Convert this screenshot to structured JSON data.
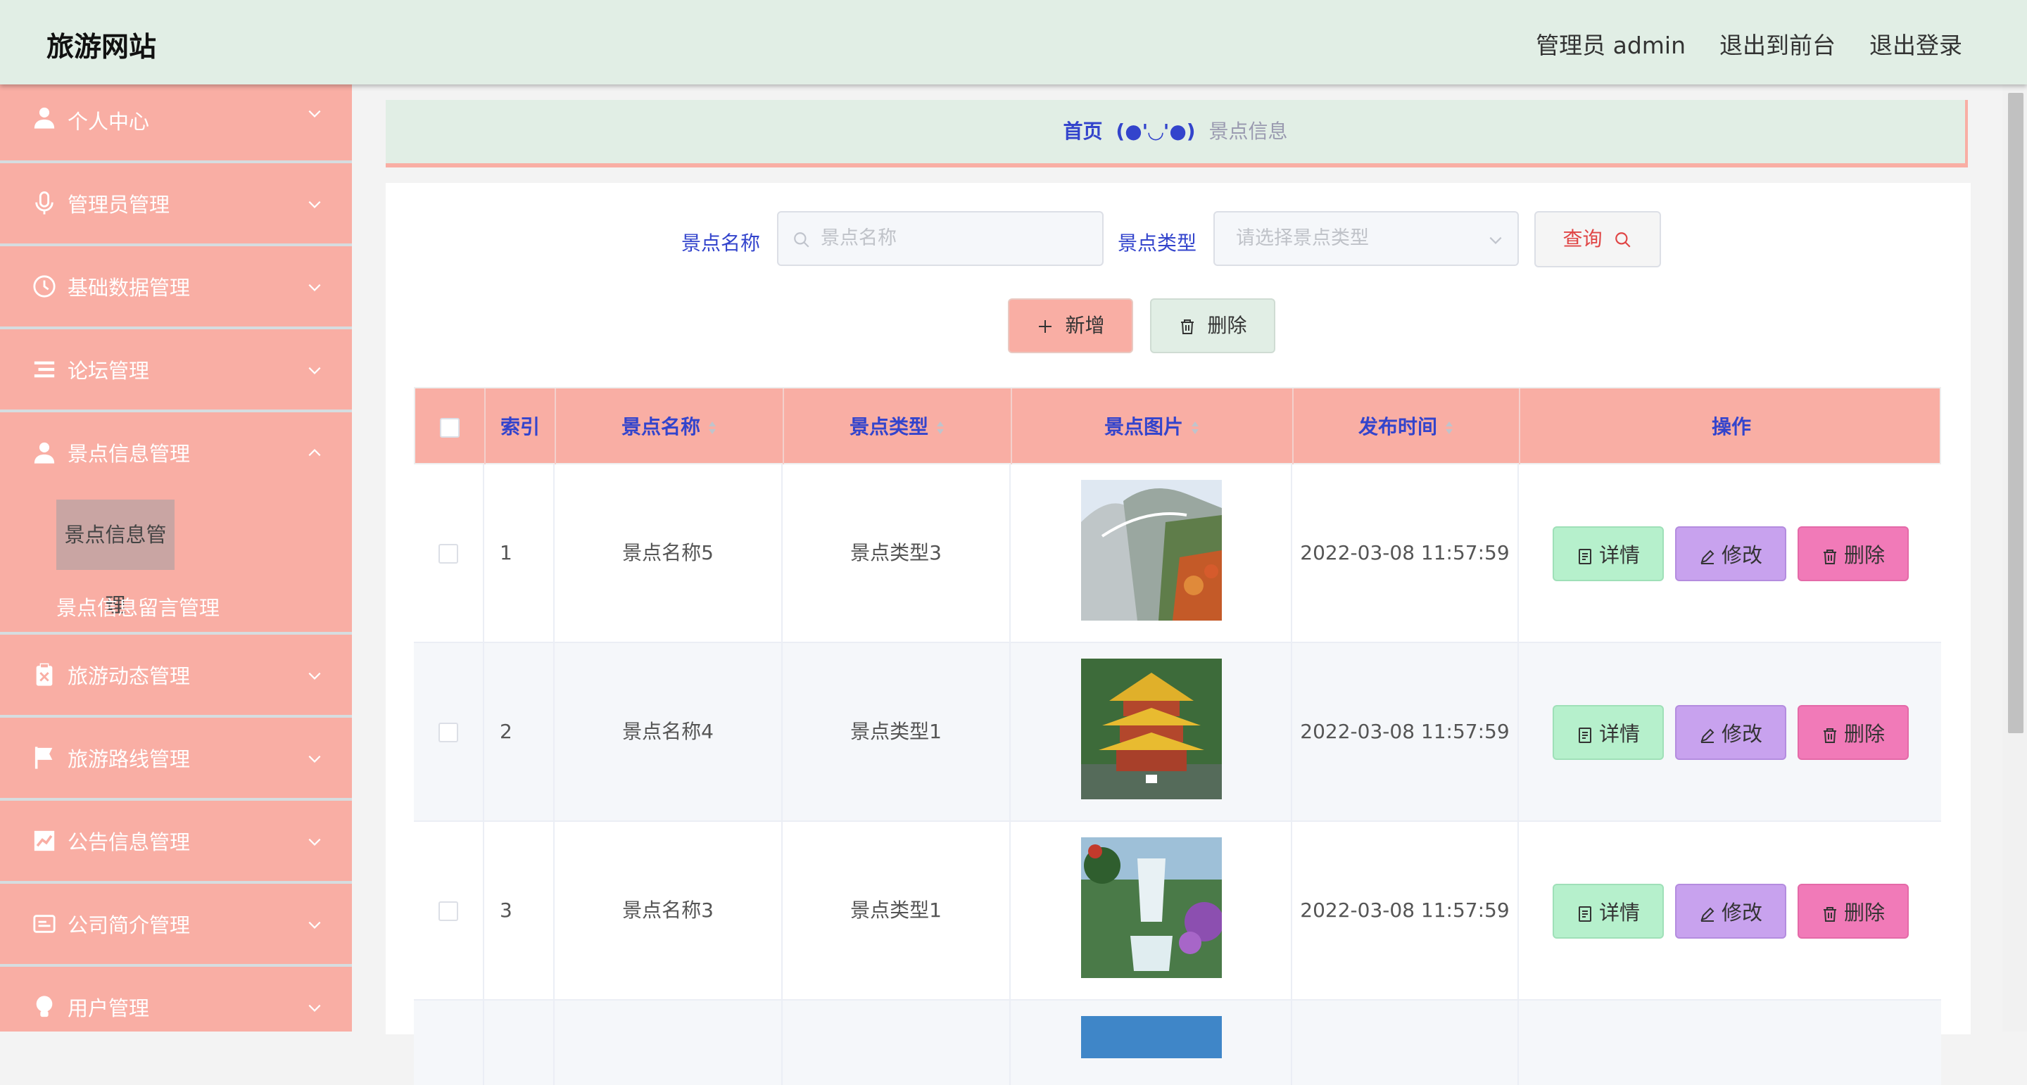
{
  "header": {
    "title": "旅游网站",
    "admin_label": "管理员 admin",
    "to_front": "退出到前台",
    "logout": "退出登录"
  },
  "sidebar": {
    "items": [
      {
        "label": "个人中心",
        "icon": "user-icon"
      },
      {
        "label": "管理员管理",
        "icon": "microphone-icon"
      },
      {
        "label": "基础数据管理",
        "icon": "clock-icon"
      },
      {
        "label": "论坛管理",
        "icon": "list-icon"
      },
      {
        "label": "景点信息管理",
        "icon": "user-icon"
      },
      {
        "label": "旅游动态管理",
        "icon": "clipboard-icon"
      },
      {
        "label": "旅游路线管理",
        "icon": "flag-icon"
      },
      {
        "label": "公告信息管理",
        "icon": "chart-icon"
      },
      {
        "label": "公司简介管理",
        "icon": "card-icon"
      },
      {
        "label": "用户管理",
        "icon": "bulb-icon"
      }
    ],
    "sub_active": "景点信息管理",
    "sub_other": "景点信息留言管理"
  },
  "breadcrumb": {
    "home": "首页",
    "face": "(●'◡'●)",
    "current": "景点信息"
  },
  "search": {
    "name_label": "景点名称",
    "name_placeholder": "景点名称",
    "type_label": "景点类型",
    "type_placeholder": "请选择景点类型",
    "query_label": "查询"
  },
  "toolbar": {
    "add_label": "新增",
    "delete_label": "删除"
  },
  "table": {
    "columns": [
      "索引",
      "景点名称",
      "景点类型",
      "景点图片",
      "发布时间",
      "操作"
    ],
    "rows": [
      {
        "index": "1",
        "name": "景点名称5",
        "type": "景点类型3",
        "time": "2022-03-08 11:57:59",
        "image": "mountain-cliff-image"
      },
      {
        "index": "2",
        "name": "景点名称4",
        "type": "景点类型1",
        "time": "2022-03-08 11:57:59",
        "image": "pagoda-tower-image"
      },
      {
        "index": "3",
        "name": "景点名称3",
        "type": "景点类型1",
        "time": "2022-03-08 11:57:59",
        "image": "waterfall-image"
      }
    ],
    "actions": {
      "detail": "详情",
      "edit": "修改",
      "delete": "删除"
    }
  },
  "colors": {
    "sidebar_bg": "#f9aea4",
    "header_bg": "#e1eee5",
    "accent_text": "#3344cc",
    "detail_btn": "#b6f0cc",
    "edit_btn": "#c8a2ee",
    "delete_btn": "#f17ab8"
  }
}
